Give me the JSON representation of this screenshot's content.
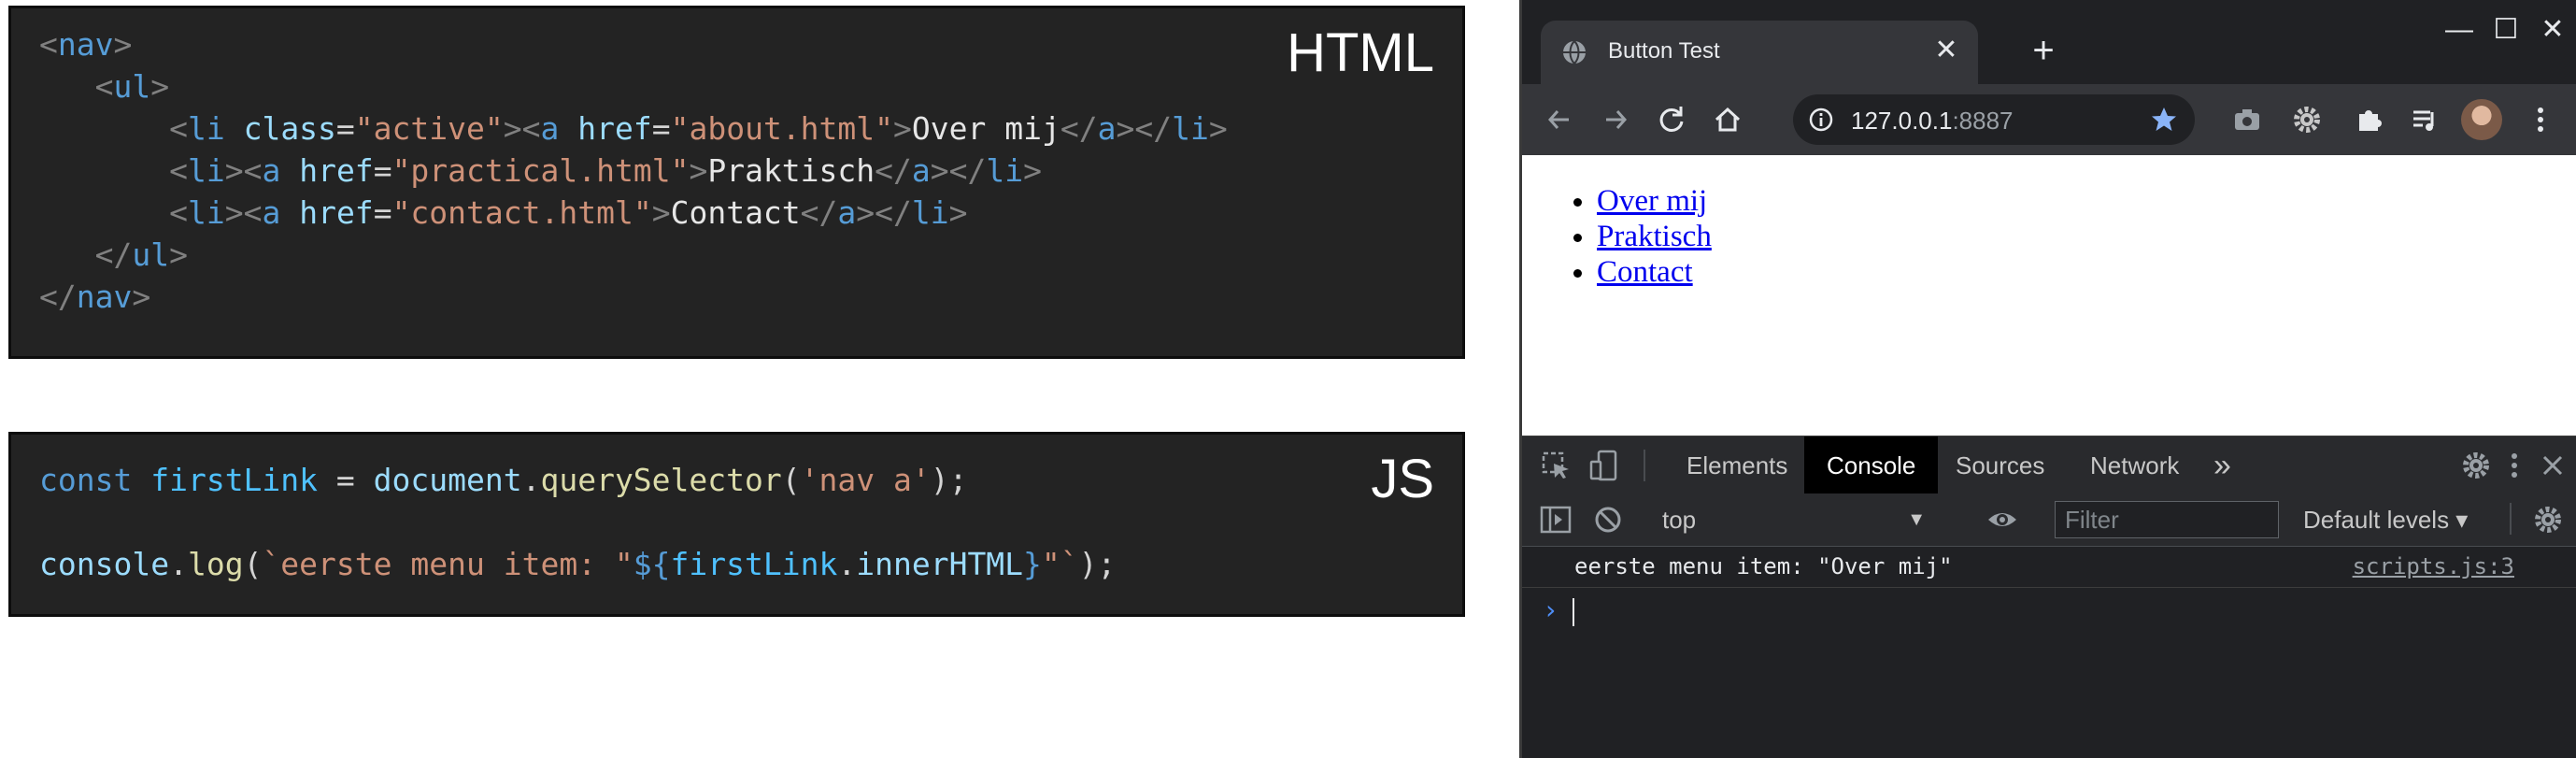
{
  "html_panel": {
    "label": "HTML",
    "lines": {
      "l1": {
        "lt": "<",
        "tag": "nav",
        "gt": ">"
      },
      "l2": {
        "indent": "   ",
        "lt": "<",
        "tag": "ul",
        "gt": ">"
      },
      "l3": {
        "indent": "       ",
        "lt": "<",
        "tag": "li",
        "sp": " ",
        "attr": "class",
        "eq": "=",
        "val": "\"active\"",
        "gt": ">",
        "lt2": "<",
        "tag2": "a",
        "sp2": " ",
        "attr2": "href",
        "eq2": "=",
        "val2": "\"about.html\"",
        "gt2": ">",
        "text": "Over mij",
        "close1": "</",
        "ctag1": "a",
        "cgt1": ">",
        "close2": "</",
        "ctag2": "li",
        "cgt2": ">"
      },
      "l4": {
        "indent": "       ",
        "lt": "<",
        "tag": "li",
        "gt": ">",
        "lt2": "<",
        "tag2": "a",
        "sp2": " ",
        "attr2": "href",
        "eq2": "=",
        "val2": "\"practical.html\"",
        "gt2": ">",
        "text": "Praktisch",
        "close1": "</",
        "ctag1": "a",
        "cgt1": ">",
        "close2": "</",
        "ctag2": "li",
        "cgt2": ">"
      },
      "l5": {
        "indent": "       ",
        "lt": "<",
        "tag": "li",
        "gt": ">",
        "lt2": "<",
        "tag2": "a",
        "sp2": " ",
        "attr2": "href",
        "eq2": "=",
        "val2": "\"contact.html\"",
        "gt2": ">",
        "text": "Contact",
        "close1": "</",
        "ctag1": "a",
        "cgt1": ">",
        "close2": "</",
        "ctag2": "li",
        "cgt2": ">"
      },
      "l6": {
        "indent": "   ",
        "lt": "</",
        "tag": "ul",
        "gt": ">"
      },
      "l7": {
        "lt": "</",
        "tag": "nav",
        "gt": ">"
      }
    }
  },
  "js_panel": {
    "label": "JS",
    "line1": {
      "kw": "const",
      "sp": " ",
      "var": "firstLink",
      "eq": " = ",
      "obj": "document",
      "dot": ".",
      "fn": "querySelector",
      "open": "(",
      "str": "'nav a'",
      "close": ");"
    },
    "line2": {
      "obj": "console",
      "dot": ".",
      "fn": "log",
      "open": "(",
      "str1": "`eerste menu item: \"",
      "dollar": "${",
      "var": "firstLink",
      "dot2": ".",
      "prop": "innerHTML",
      "brace": "}",
      "str2": "\"`",
      "close": ");"
    }
  },
  "browser": {
    "tab": {
      "title": "Button Test",
      "favicon": "globe-icon",
      "close": "✕"
    },
    "new_tab": "+",
    "window": {
      "minimize": "—",
      "maximize": "☐",
      "close": "✕"
    },
    "url": {
      "host": "127.0.0.1",
      "port": ":8887"
    },
    "page": {
      "links": [
        "Over mij",
        "Praktisch",
        "Contact"
      ]
    },
    "devtools": {
      "tabs": [
        "Elements",
        "Console",
        "Sources",
        "Network"
      ],
      "more": "»",
      "context": "top",
      "filter_placeholder": "Filter",
      "levels": "Default levels ▾",
      "log_message": "eerste menu item: \"Over mij\"",
      "log_source": "scripts.js:3",
      "prompt": "›"
    }
  },
  "colors": {
    "accent": "#569cd6",
    "string": "#ce9178",
    "console_bg": "#202124"
  }
}
